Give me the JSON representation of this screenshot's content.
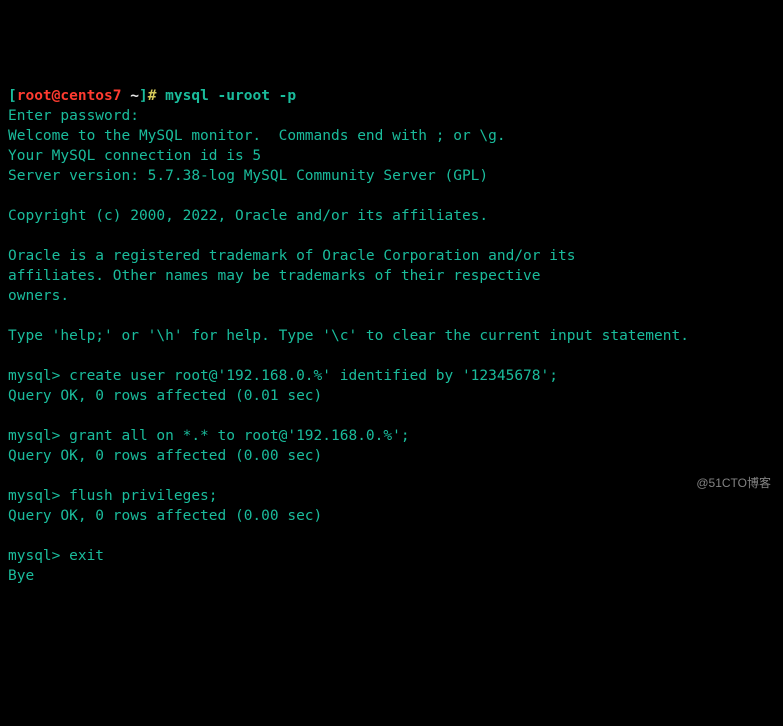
{
  "prompt": {
    "open_bracket": "[",
    "user_host": "root@centos7",
    "tilde": " ~",
    "close_bracket": "]",
    "hash": "# ",
    "command": "mysql -uroot -p"
  },
  "session": {
    "enter_password": "Enter password:",
    "welcome": "Welcome to the MySQL monitor.  Commands end with ; or \\g.",
    "conn_id": "Your MySQL connection id is 5",
    "server_version": "Server version: 5.7.38-log MySQL Community Server (GPL)",
    "copyright": "Copyright (c) 2000, 2022, Oracle and/or its affiliates.",
    "trademark1": "Oracle is a registered trademark of Oracle Corporation and/or its",
    "trademark2": "affiliates. Other names may be trademarks of their respective",
    "trademark3": "owners.",
    "help_line": "Type 'help;' or '\\h' for help. Type '\\c' to clear the current input statement."
  },
  "mysql": {
    "prompt": "mysql> ",
    "cmd1": "create user root@'192.168.0.%' identified by '12345678';",
    "res1": "Query OK, 0 rows affected (0.01 sec)",
    "cmd2": "grant all on *.* to root@'192.168.0.%';",
    "res2": "Query OK, 0 rows affected (0.00 sec)",
    "cmd3": "flush privileges;",
    "res3": "Query OK, 0 rows affected (0.00 sec)",
    "cmd4": "exit",
    "bye": "Bye"
  },
  "watermark": "@51CTO博客"
}
